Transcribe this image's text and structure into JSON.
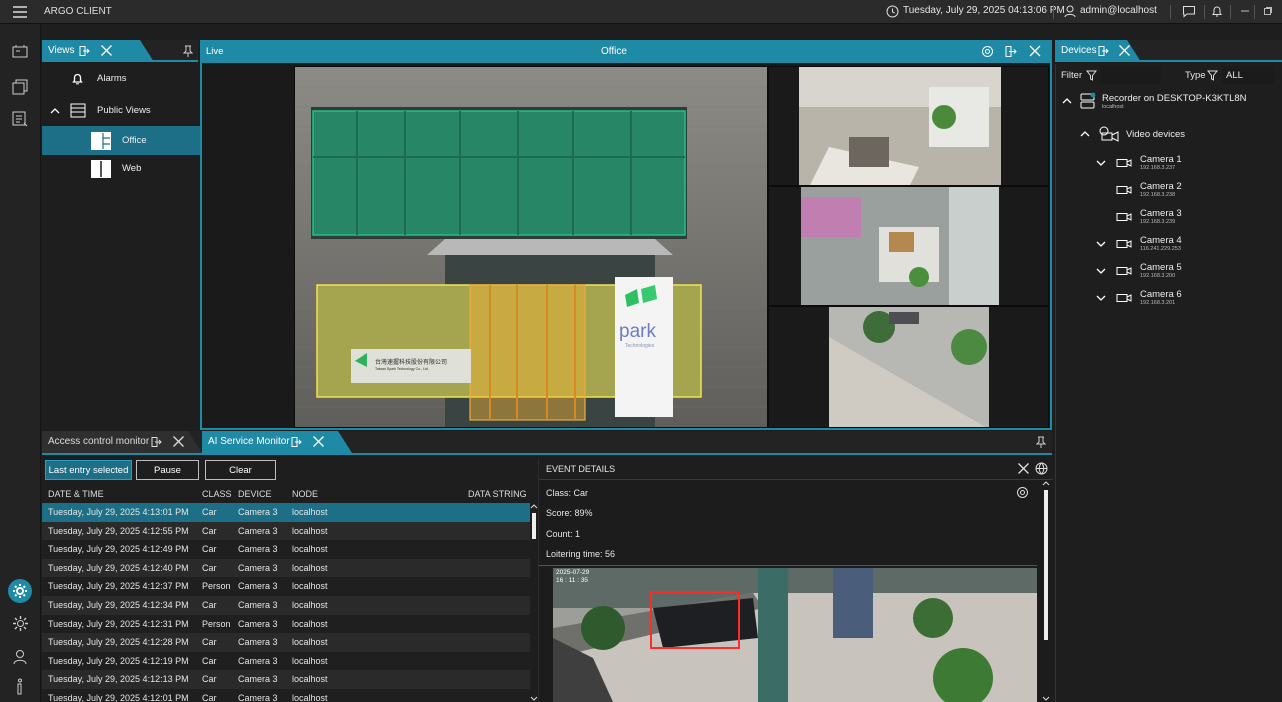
{
  "app": {
    "title": "ARGO CLIENT",
    "datetime": "Tuesday, July 29, 2025 04:13:06 PM",
    "user": "admin@localhost"
  },
  "views_panel": {
    "tab": "Views",
    "items": [
      {
        "label": "Alarms"
      },
      {
        "label": "Public Views"
      },
      {
        "label": "Office"
      },
      {
        "label": "Web"
      }
    ]
  },
  "live_panel": {
    "tab": "Live",
    "view_title": "Office"
  },
  "devices_panel": {
    "tab": "Devices",
    "filter_label": "Filter",
    "type_label": "Type",
    "type_value": "ALL",
    "recorder": {
      "name": "Recorder on DESKTOP-K3KTL8N",
      "host": "localhost"
    },
    "group": "Video devices",
    "cameras": [
      {
        "name": "Camera 1",
        "ip": "192.168.3.237",
        "expandable": true
      },
      {
        "name": "Camera 2",
        "ip": "192.168.3.238",
        "expandable": false
      },
      {
        "name": "Camera 3",
        "ip": "192.168.3.239",
        "expandable": false
      },
      {
        "name": "Camera 4",
        "ip": "116.241.229.253",
        "expandable": true
      },
      {
        "name": "Camera 5",
        "ip": "192.168.3.200",
        "expandable": true
      },
      {
        "name": "Camera 6",
        "ip": "192.168.3.201",
        "expandable": true
      }
    ]
  },
  "bottom": {
    "tab_access": "Access control monitor",
    "tab_ai": "AI Service Monitor",
    "buttons": {
      "last_entry": "Last entry selected",
      "pause": "Pause",
      "clear": "Clear"
    },
    "columns": [
      "DATE & TIME",
      "CLASS",
      "DEVICE",
      "NODE",
      "DATA STRING"
    ],
    "rows": [
      [
        "Tuesday, July 29, 2025 4:13:01 PM",
        "Car",
        "Camera 3",
        "localhost"
      ],
      [
        "Tuesday, July 29, 2025 4:12:55 PM",
        "Car",
        "Camera 3",
        "localhost"
      ],
      [
        "Tuesday, July 29, 2025 4:12:49 PM",
        "Car",
        "Camera 3",
        "localhost"
      ],
      [
        "Tuesday, July 29, 2025 4:12:40 PM",
        "Car",
        "Camera 3",
        "localhost"
      ],
      [
        "Tuesday, July 29, 2025 4:12:37 PM",
        "Person",
        "Camera 3",
        "localhost"
      ],
      [
        "Tuesday, July 29, 2025 4:12:34 PM",
        "Car",
        "Camera 3",
        "localhost"
      ],
      [
        "Tuesday, July 29, 2025 4:12:31 PM",
        "Person",
        "Camera 3",
        "localhost"
      ],
      [
        "Tuesday, July 29, 2025 4:12:28 PM",
        "Car",
        "Camera 3",
        "localhost"
      ],
      [
        "Tuesday, July 29, 2025 4:12:19 PM",
        "Car",
        "Camera 3",
        "localhost"
      ],
      [
        "Tuesday, July 29, 2025 4:12:13 PM",
        "Car",
        "Camera 3",
        "localhost"
      ],
      [
        "Tuesday, July 29, 2025 4:12:01 PM",
        "Car",
        "Camera 3",
        "localhost"
      ]
    ],
    "event": {
      "header": "EVENT DETAILS",
      "class": "Class: Car",
      "score": "Score: 89%",
      "count": "Count: 1",
      "loitering": "Loitering time: 56",
      "snapshot_date": "2025-07-29",
      "snapshot_time": "16 : 11 : 35"
    }
  },
  "overlay": {
    "sign_cn": "台灣速握科技股份有限公司",
    "sign_en": "Taiwan Spark Technology Co., Ltd.",
    "park_text": "park",
    "park_sub": "Technologies"
  },
  "colors": {
    "accent": "#1f8aa6",
    "selected": "#1c6f86",
    "zone_green": "#21c28a",
    "zone_yellow": "#f2e34d",
    "bbox": "#ff2a2a"
  }
}
